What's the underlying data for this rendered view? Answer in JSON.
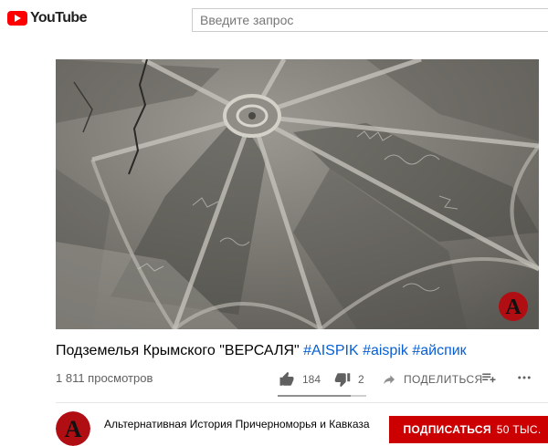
{
  "header": {
    "logo_text": "YouTube",
    "search_placeholder": "Введите запрос"
  },
  "video": {
    "title_main": "Подземелья Крымского \"ВЕРСАЛЯ\"",
    "hashtags": [
      "#AISPIK",
      "#aispik",
      "#айспик"
    ],
    "views": "1 811 просмотров",
    "likes": "184",
    "dislikes": "2",
    "share_label": "ПОДЕЛИТЬСЯ",
    "like_ratio": 0.82,
    "watermark_letter": "A"
  },
  "channel": {
    "name": "Альтернативная История Причерноморья и Кавказа",
    "subscribe_label": "ПОДПИСАТЬСЯ",
    "subscriber_count": "50 ТЫС."
  },
  "colors": {
    "brand_red": "#ff0000",
    "subscribe_red": "#cc0000",
    "hashtag_blue": "#065fd4",
    "meta_gray": "#606060"
  }
}
